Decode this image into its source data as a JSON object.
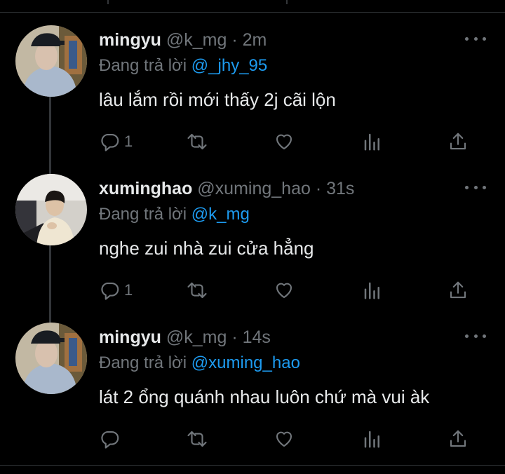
{
  "tweets": [
    {
      "name": "mingyu",
      "handle": "@k_mg",
      "dot": "·",
      "time": "2m",
      "reply_prefix": "Đang trả lời",
      "reply_to": "@_jhy_95",
      "text": "lâu lắm rồi mới thấy 2j cãi lộn",
      "reply_count": "1"
    },
    {
      "name": "xuminghao",
      "handle": "@xuming_hao",
      "dot": "·",
      "time": "31s",
      "reply_prefix": "Đang trả lời",
      "reply_to": "@k_mg",
      "text": "nghe zui nhà zui cửa hẳng",
      "reply_count": "1"
    },
    {
      "name": "mingyu",
      "handle": "@k_mg",
      "dot": "·",
      "time": "14s",
      "reply_prefix": "Đang trả lời",
      "reply_to": "@xuming_hao",
      "text": "lát 2 ổng quánh nhau luôn chứ mà vui àk",
      "reply_count": ""
    }
  ],
  "icons": {
    "more": "more-horizontal-icon",
    "reply": "reply-icon",
    "retweet": "retweet-icon",
    "like": "heart-icon",
    "views": "views-icon",
    "share": "share-icon"
  },
  "colors": {
    "background": "#000000",
    "text": "#e7e9ea",
    "secondary": "#71767b",
    "link": "#1d9bf0",
    "divider": "#2f3336"
  }
}
